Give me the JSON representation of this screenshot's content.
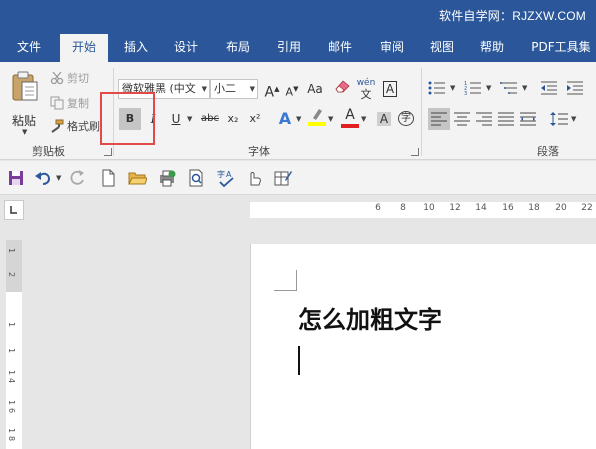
{
  "watermark": "软件自学网：RJZXW.COM",
  "tabs": [
    {
      "label": "文件"
    },
    {
      "label": "开始"
    },
    {
      "label": "插入"
    },
    {
      "label": "设计"
    },
    {
      "label": "布局"
    },
    {
      "label": "引用"
    },
    {
      "label": "邮件"
    },
    {
      "label": "审阅"
    },
    {
      "label": "视图"
    },
    {
      "label": "帮助"
    },
    {
      "label": "PDF工具集"
    }
  ],
  "clipboard": {
    "paste_label": "粘贴",
    "cut_label": "剪切",
    "copy_label": "复制",
    "format_painter_label": "格式刷",
    "group_label": "剪贴板"
  },
  "font": {
    "family_value": "微软雅黑 (中文",
    "size_value": "小二",
    "group_label": "字体",
    "bold": "B",
    "italic": "I",
    "underline": "U",
    "strike": "abc",
    "subscript": "x₂",
    "superscript": "x²",
    "grow": "A",
    "shrink": "A",
    "aa": "Aa",
    "phonetic": "wén",
    "border_char": "A",
    "effect": "A",
    "font_color": "A",
    "shading": "A",
    "circle_char": "字"
  },
  "paragraph": {
    "group_label": "段落"
  },
  "ruler": {
    "h_numbers": [
      "6",
      "8",
      "10",
      "12",
      "14",
      "16",
      "18",
      "20",
      "22"
    ],
    "v_numbers": [
      "1",
      "2",
      "1",
      "1",
      "1",
      "4",
      "1",
      "6",
      "1",
      "8"
    ]
  },
  "document": {
    "heading": "怎么加粗文字"
  },
  "colors": {
    "accent": "#2b579a",
    "highlight_box": "#e24a4a",
    "font_color_bar": "#e02020",
    "highlight_bar": "#ffff00"
  }
}
